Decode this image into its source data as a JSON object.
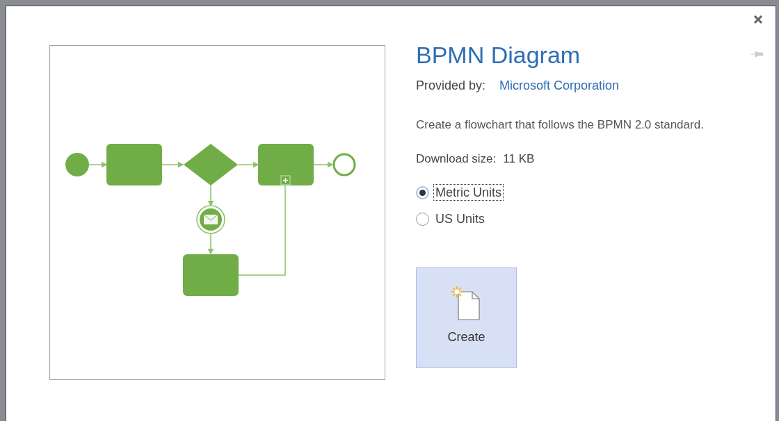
{
  "template": {
    "title": "BPMN Diagram",
    "provider_label": "Provided by:",
    "provider": "Microsoft Corporation",
    "description": "Create a flowchart that follows the BPMN 2.0 standard.",
    "download_label": "Download size:",
    "download_size": "11 KB"
  },
  "units": [
    {
      "label": "Metric Units",
      "selected": true,
      "focused": true
    },
    {
      "label": "US Units",
      "selected": false,
      "focused": false
    }
  ],
  "create_button": {
    "label": "Create"
  }
}
